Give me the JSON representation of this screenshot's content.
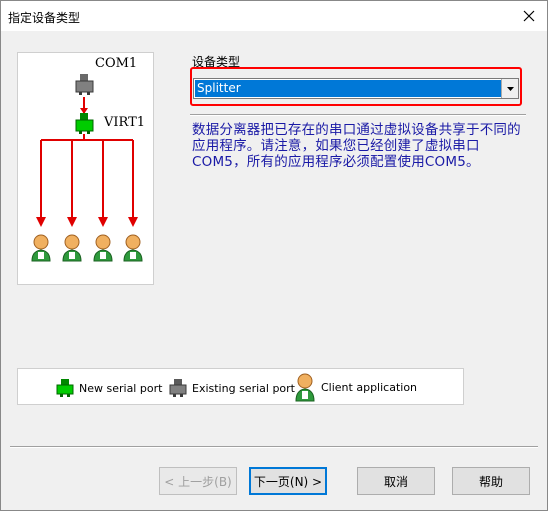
{
  "window": {
    "title": "指定设备类型"
  },
  "diagram": {
    "com_label": "COM1",
    "virt_label": "VIRT1"
  },
  "device_type": {
    "label": "设备类型",
    "selected": "Splitter",
    "description": "数据分离器把已存在的串口通过虚拟设备共享于不同的应用程序。请注意，如果您已经创建了虚拟串口COM5，所有的应用程序必须配置使用COM5。"
  },
  "legend": {
    "new_port": "New serial port",
    "existing_port": "Existing serial port",
    "client_app": "Client application"
  },
  "buttons": {
    "back": "< 上一步(B)",
    "next": "下一页(N) >",
    "cancel": "取消",
    "help": "帮助"
  },
  "colors": {
    "new_port": "#00cc00",
    "existing_port": "#808080",
    "arrow": "#e00000",
    "highlight_frame": "#ff0000",
    "selection": "#0078d7",
    "description_text": "#1a1aa6"
  }
}
